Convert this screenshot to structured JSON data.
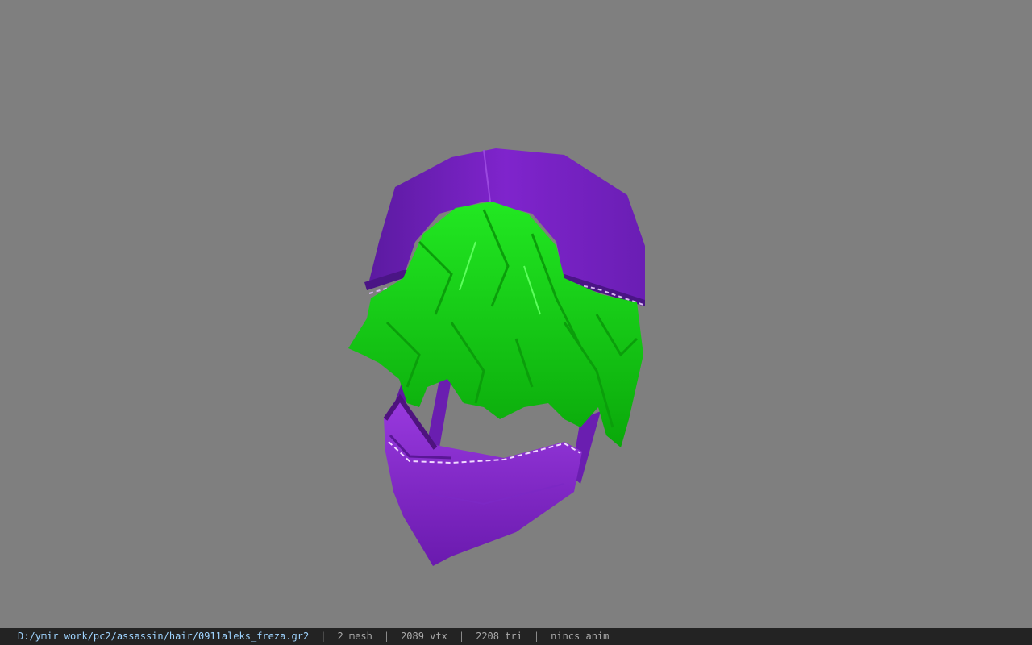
{
  "viewer": {
    "background_color": "#7f7f7f",
    "model_colors": {
      "cap": "#7a22c4",
      "hair": "#12d812",
      "mask": "#8a2ed0"
    }
  },
  "status_bar": {
    "file_path": "D:/ymir work/pc2/assassin/hair/0911aleks_freza.gr2",
    "separator": "|",
    "mesh_count": "2 mesh",
    "vertex_count": "2089 vtx",
    "triangle_count": "2208 tri",
    "anim_status": "nincs anim"
  }
}
